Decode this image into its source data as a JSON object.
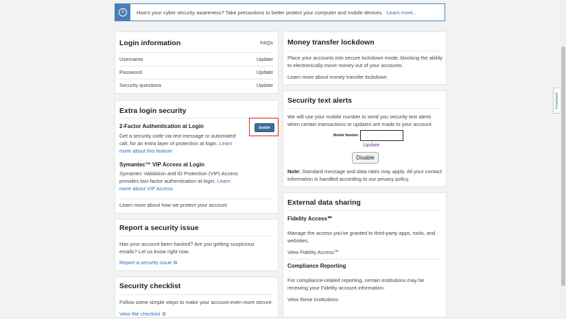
{
  "banner": {
    "icon": "info-icon",
    "message": "How's your cyber security awareness? Take precautions to better protect your computer and mobile devices.",
    "link": "Learn more..."
  },
  "login_info": {
    "title": "Login information",
    "faqs": "FAQs",
    "rows": [
      {
        "label": "Username",
        "action": "Update"
      },
      {
        "label": "Password",
        "action": "Update"
      },
      {
        "label": "Security questions",
        "action": "Update"
      }
    ]
  },
  "extra_security": {
    "title": "Extra login security",
    "twofa": {
      "title": "2-Factor Authentication at Login",
      "button": "Enable",
      "desc": "Get a security code via text message or automated call, for an extra layer of protection at login.",
      "link": "Learn more about this feature"
    },
    "vip": {
      "title": "Symantec™ VIP Access at Login",
      "desc": "Symantec Validation and ID Protection (VIP) Access provides two-factor authentication at login.",
      "link": "Learn more about VIP Access"
    },
    "footer_link": "Learn more about how we protect your account"
  },
  "report_issue": {
    "title": "Report a security issue",
    "desc": "Has your account been hacked? Are you getting suspicious emails? Let us know right now.",
    "link": "Report a security issue"
  },
  "checklist": {
    "title": "Security checklist",
    "desc": "Follow some simple steps to make your account even more secure.",
    "link": "View the checklist"
  },
  "money_lockdown": {
    "title": "Money transfer lockdown",
    "desc": "Place your accounts into secure lockdown mode, blocking the ability to electronically move money out of your accounts.",
    "link": "Learn more about money transfer lockdown"
  },
  "text_alerts": {
    "title": "Security text alerts",
    "desc": "We will use your mobile number to send you security text alerts when certain transactions or updates are made to your account.",
    "mobile_label": "Mobile Number:",
    "mobile_value": "",
    "update": "Update",
    "disable": "Disable",
    "note_label": "Note:",
    "note": "Standard message and data rates may apply. All your contact information is handled according to our privacy policy."
  },
  "external_sharing": {
    "title": "External data sharing",
    "fidelity_access": {
      "title": "Fidelity Access℠",
      "desc": "Manage the access you've granted to third-party apps, tools, and websites.",
      "link": "View Fidelity Access℠"
    },
    "compliance": {
      "title": "Compliance Reporting",
      "desc": "For compliance-related reporting, certain institutions may be receiving your Fidelity account information.",
      "link": "View these institutions"
    }
  },
  "feedback": "Feedback",
  "colors": {
    "accent": "#2a6ebb",
    "banner_border": "#4a7fb5",
    "highlight": "#dd2222"
  }
}
